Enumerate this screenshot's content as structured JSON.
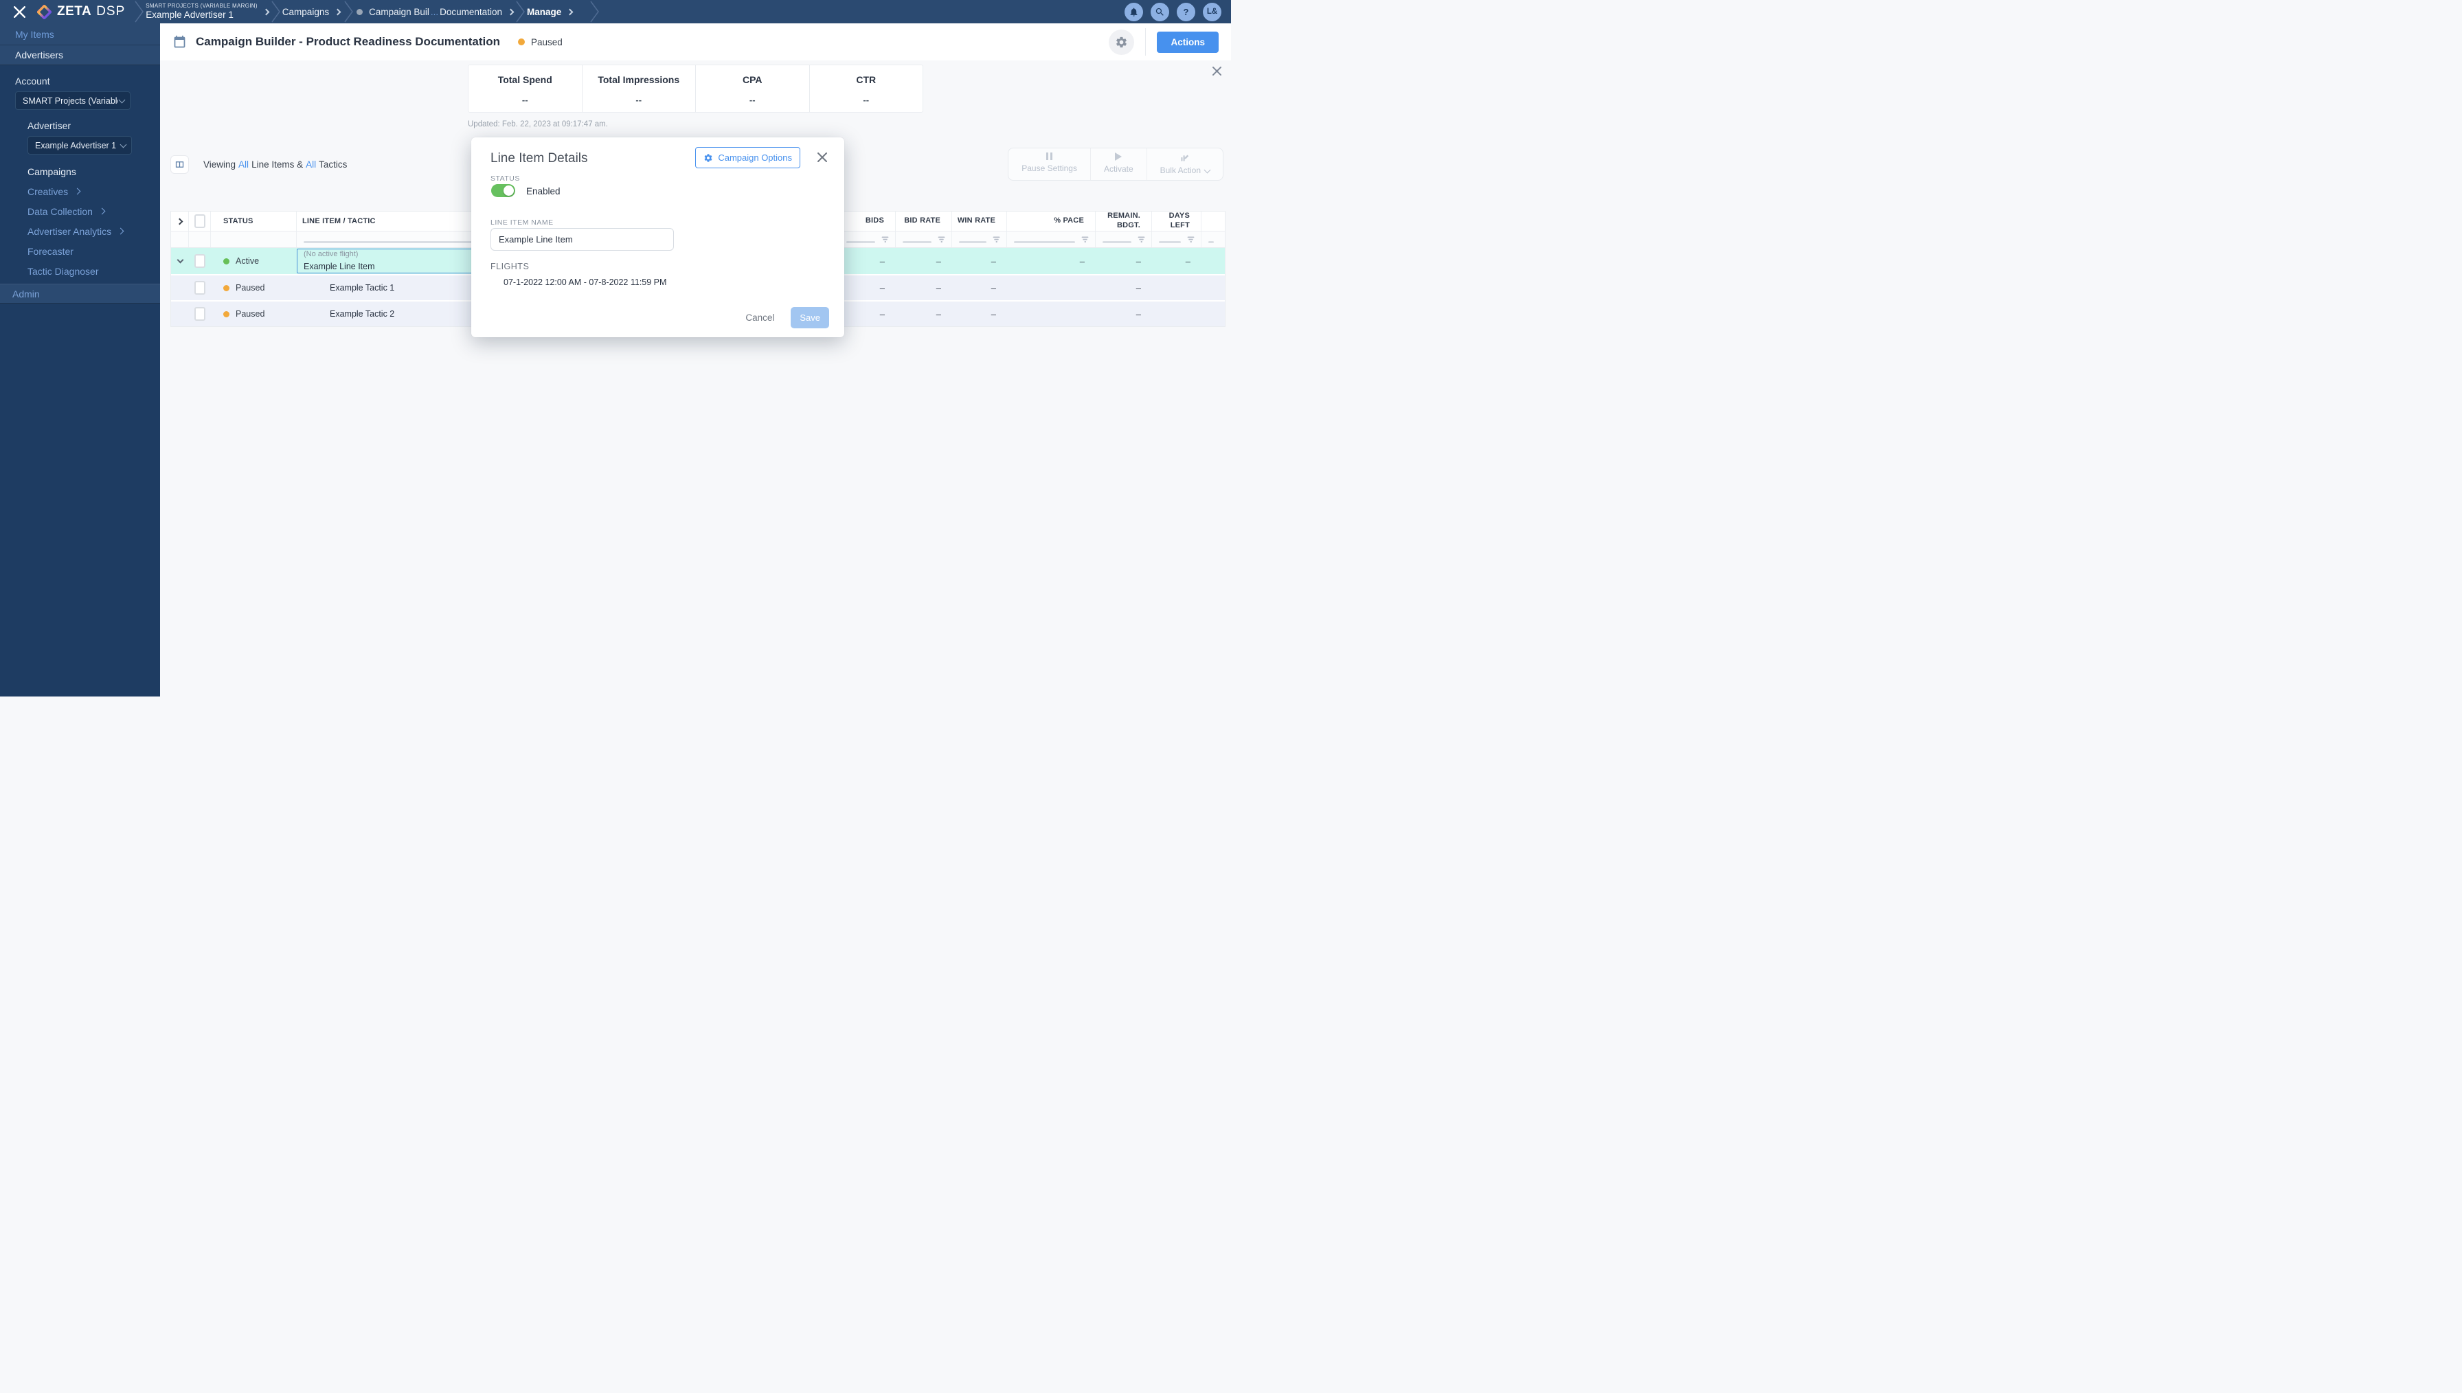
{
  "topbar": {
    "brand": {
      "name": "ZETA",
      "suffix": "DSP"
    },
    "breadcrumbs": {
      "account_label": "SMART PROJECTS (VARIABLE MARGIN)",
      "advertiser": "Example Advertiser 1",
      "campaigns": "Campaigns",
      "campaign_pre": "Campaign Buil",
      "campaign_dots": "...",
      "campaign_post": "Documentation",
      "manage": "Manage"
    },
    "help": "?",
    "avatar": "L&"
  },
  "sidebar": {
    "my_items": "My Items",
    "advertisers": "Advertisers",
    "account_label": "Account",
    "account_value": "SMART Projects (Variable M...",
    "advertiser_label": "Advertiser",
    "advertiser_value": "Example Advertiser 1",
    "items": [
      {
        "label": "Campaigns"
      },
      {
        "label": "Creatives"
      },
      {
        "label": "Data Collection"
      },
      {
        "label": "Advertiser Analytics"
      },
      {
        "label": "Forecaster"
      },
      {
        "label": "Tactic Diagnoser"
      }
    ],
    "admin": "Admin"
  },
  "header": {
    "title": "Campaign Builder - Product Readiness Documentation",
    "status": "Paused",
    "actions_label": "Actions"
  },
  "stats": {
    "items": [
      {
        "label": "Total Spend",
        "value": "--"
      },
      {
        "label": "Total Impressions",
        "value": "--"
      },
      {
        "label": "CPA",
        "value": "--"
      },
      {
        "label": "CTR",
        "value": "--"
      }
    ],
    "updated": "Updated: Feb. 22, 2023 at 09:17:47 am."
  },
  "toolbar": {
    "viewing_prefix": "Viewing",
    "all1": "All",
    "mid": "Line Items &",
    "all2": "All",
    "suffix": "Tactics",
    "pause_settings": "Pause Settings",
    "activate": "Activate",
    "bulk_action": "Bulk Action"
  },
  "table": {
    "columns": [
      "STATUS",
      "LINE ITEM / TACTIC",
      "BIDS",
      "BID RATE",
      "WIN RATE",
      "% PACE",
      "REMAIN. BDGT.",
      "DAYS LEFT"
    ],
    "rows": [
      {
        "status": "Active",
        "flight_note": "(No active flight)",
        "name": "Example Line Item",
        "bids": "–",
        "bid_rate": "–",
        "win_rate": "–",
        "pace": "–",
        "remain_bdgt": "–",
        "days_left": "–"
      },
      {
        "status": "Paused",
        "name": "Example Tactic 1",
        "bids": "–",
        "bid_rate": "–",
        "win_rate": "–",
        "pace": "",
        "remain_bdgt": "–",
        "days_left": ""
      },
      {
        "status": "Paused",
        "name": "Example Tactic 2",
        "bids": "–",
        "bid_rate": "–",
        "win_rate": "–",
        "pace": "",
        "remain_bdgt": "–",
        "days_left": ""
      }
    ]
  },
  "modal": {
    "title": "Line Item Details",
    "campaign_options": "Campaign Options",
    "status_label": "STATUS",
    "status_value": "Enabled",
    "name_label": "LINE ITEM NAME",
    "name_value": "Example Line Item",
    "flights_label": "FLIGHTS",
    "flight": "07-1-2022 12:00 AM - 07-8-2022 11:59 PM",
    "cancel": "Cancel",
    "save": "Save"
  },
  "colors": {
    "accent": "#4791ee",
    "active_dot": "#67bf58",
    "paused_dot": "#f2a93b",
    "toggle_on": "#67c05f",
    "selected_row": "#cef7f0",
    "topbar": "#2b4a71",
    "sidebar_dark": "#1e3c62"
  }
}
